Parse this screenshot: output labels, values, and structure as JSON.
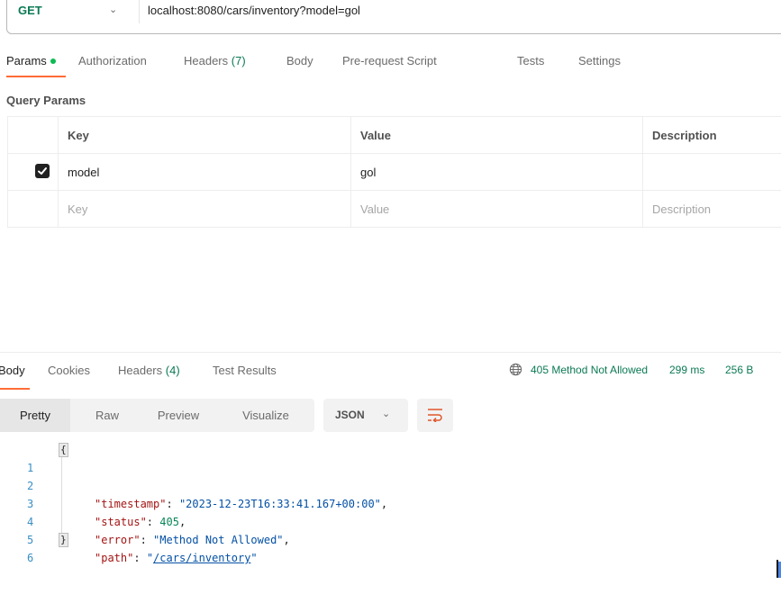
{
  "request": {
    "method": "GET",
    "url": "localhost:8080/cars/inventory?model=gol"
  },
  "request_tabs": [
    {
      "label": "Params",
      "active": true,
      "has_dot": true
    },
    {
      "label": "Authorization"
    },
    {
      "label": "Headers",
      "count": "(7)"
    },
    {
      "label": "Body"
    },
    {
      "label": "Pre-request Script"
    },
    {
      "label": "Tests"
    },
    {
      "label": "Settings"
    }
  ],
  "query_params": {
    "title": "Query Params",
    "columns": [
      "Key",
      "Value",
      "Description"
    ],
    "rows": [
      {
        "checked": true,
        "key": "model",
        "value": "gol",
        "description": ""
      }
    ],
    "placeholder_row": {
      "key": "Key",
      "value": "Value",
      "description": "Description"
    }
  },
  "response_tabs": [
    {
      "label": "Body",
      "active": true
    },
    {
      "label": "Cookies"
    },
    {
      "label": "Headers",
      "count": "(4)"
    },
    {
      "label": "Test Results"
    }
  ],
  "response_status": {
    "status": "405 Method Not Allowed",
    "time": "299 ms",
    "size": "256 B",
    "color": "#0c7a54"
  },
  "view_modes": [
    "Pretty",
    "Raw",
    "Preview",
    "Visualize"
  ],
  "active_view": "Pretty",
  "format": "JSON",
  "body_lines": [
    {
      "n": "1",
      "text": "{"
    },
    {
      "n": "2",
      "key": "\"timestamp\"",
      "value": "\"2023-12-23T16:33:41.167+00:00\"",
      "type": "string",
      "trail": ","
    },
    {
      "n": "3",
      "key": "\"status\"",
      "value": "405",
      "type": "number",
      "trail": ","
    },
    {
      "n": "4",
      "key": "\"error\"",
      "value": "\"Method Not Allowed\"",
      "type": "string",
      "trail": ","
    },
    {
      "n": "5",
      "key": "\"path\"",
      "value_prefix": "\"",
      "value_link": "/cars/inventory",
      "value_suffix": "\"",
      "type": "link",
      "trail": ""
    },
    {
      "n": "6",
      "text": "}"
    }
  ],
  "colors": {
    "accent": "#ff6c37",
    "success_green": "#0c7a54",
    "dot_green": "#0cbb52",
    "json_key": "#a31515",
    "json_string": "#0451a5",
    "json_number": "#098658"
  }
}
